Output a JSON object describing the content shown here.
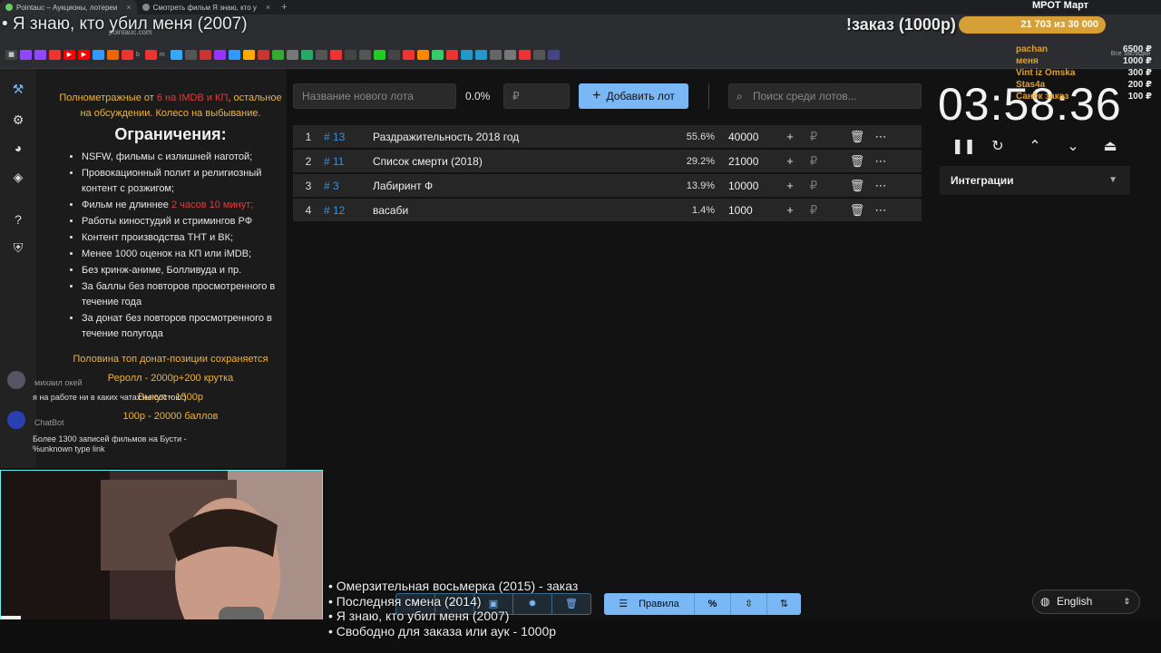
{
  "browser": {
    "tabs": [
      {
        "label": "Pointauc – Аукционы, лотереи",
        "active": true
      },
      {
        "label": "Смотреть фильм Я знаю, кто у",
        "active": false
      }
    ],
    "new_tab": "+",
    "url": "pointauc.com",
    "bookmarks_right": "Все закладки"
  },
  "overlay": {
    "stream_title": "• Я знаю, кто убил меня (2007)",
    "order_badge": "!заказ (1000р)",
    "goal_label": "МРОТ Март",
    "goal_value": "21 703  из 30 000",
    "goal_fraction": 0.7234,
    "donors": [
      {
        "name": "pachan",
        "amount": "6500 ₽"
      },
      {
        "name": "меня",
        "amount": "1000 ₽"
      },
      {
        "name": "Vint iz Omska",
        "amount": "300 ₽"
      },
      {
        "name": "Stas4a",
        "amount": "200 ₽"
      },
      {
        "name": "Санёк заказ",
        "amount": "100 ₽"
      }
    ]
  },
  "rules": {
    "intro_1": "Полнометражные от ",
    "intro_red": "6 на IMDB и КП",
    "intro_2": ", остальное на обсуждении. Колесо на выбывание.",
    "heading": "Ограничения:",
    "items": [
      "NSFW, фильмы с излишней наготой;",
      "Провокационный полит и религиозный контент с розжигом;",
      "Работы киностудий и стримингов РФ",
      "Контент производства ТНТ и ВК;",
      "Менее 1000 оценок на КП или iMDB;",
      "Без кринж-аниме, Болливуда и пр.",
      "За баллы без повторов просмотренного в течение года",
      "За донат без повторов просмотренного в течение полугода"
    ],
    "length_item": "Фильм не длиннее ",
    "length_red": "2 часов 10 минут;",
    "notes": [
      "Половина топ донат-позиции сохраняется",
      "Реролл - 2000р+200 крутка",
      "Выкуп - 1500р",
      "100р - 20000 баллов"
    ]
  },
  "auction": {
    "new_lot_placeholder": "Название нового лота",
    "percent": "0.0%",
    "amount_placeholder": "₽",
    "add_button": "Добавить лот",
    "search_placeholder": "Поиск среди лотов...",
    "lots": [
      {
        "pos": "1",
        "id": "# 13",
        "name": "Раздражительность 2018 год",
        "pct": "55.6%",
        "amount": "40000"
      },
      {
        "pos": "2",
        "id": "# 11",
        "name": "Список смерти (2018)",
        "pct": "29.2%",
        "amount": "21000"
      },
      {
        "pos": "3",
        "id": "# 3",
        "name": "Лабиринт Ф",
        "pct": "13.9%",
        "amount": "10000"
      },
      {
        "pos": "4",
        "id": "# 12",
        "name": "васаби",
        "pct": "1.4%",
        "amount": "1000"
      }
    ],
    "timer": "03:58:36",
    "integrations": "Интеграции"
  },
  "chat": [
    {
      "name": "михаил окей",
      "text": "я на работе ни в каких чатах не состою )"
    },
    {
      "name": "ChatBot",
      "text": "Более 1300 записей фильмов на Бусти - %unknown type link"
    }
  ],
  "queue": [
    "• Омерзительная восьмерка (2015) - заказ",
    "• Последняя смена (2014)",
    "• Я знаю, кто убил меня (2007)",
    "• Свободно для заказа или аук - 1000р"
  ],
  "toolbar": {
    "rules_label": "Правила",
    "percent_icon": "%"
  },
  "language": "English",
  "colors": {
    "accent": "#7ab8f5",
    "lot_id": "#3a8fd8",
    "highlight": "#f0b33a",
    "red": "#e23b3b",
    "goal": "#d6a037"
  }
}
